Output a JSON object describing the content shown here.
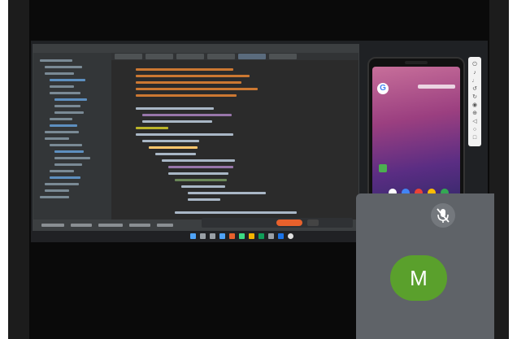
{
  "meeting": {
    "participant": {
      "avatar_letter": "M",
      "muted": true,
      "icon": "mic-off-icon",
      "avatar_color": "#5aa02c",
      "tile_color": "#5f6368"
    }
  },
  "shared_screen": {
    "app": "IDE",
    "icons": [
      "project-icon",
      "code-editor-icon"
    ]
  },
  "emulator": {
    "device_icons": [
      "google-search-icon",
      "app-icon"
    ],
    "toolbar_icons": [
      "power-icon",
      "volume-up-icon",
      "volume-down-icon",
      "rotate-left-icon",
      "rotate-right-icon",
      "camera-icon",
      "zoom-icon",
      "back-icon",
      "home-icon",
      "overview-icon",
      "more-icon"
    ],
    "google_glyph": "G"
  },
  "colors": {
    "stop_button": "#e8612c",
    "frame_bg": "#0a0a0a",
    "ide_bg": "#2b2b2b"
  }
}
